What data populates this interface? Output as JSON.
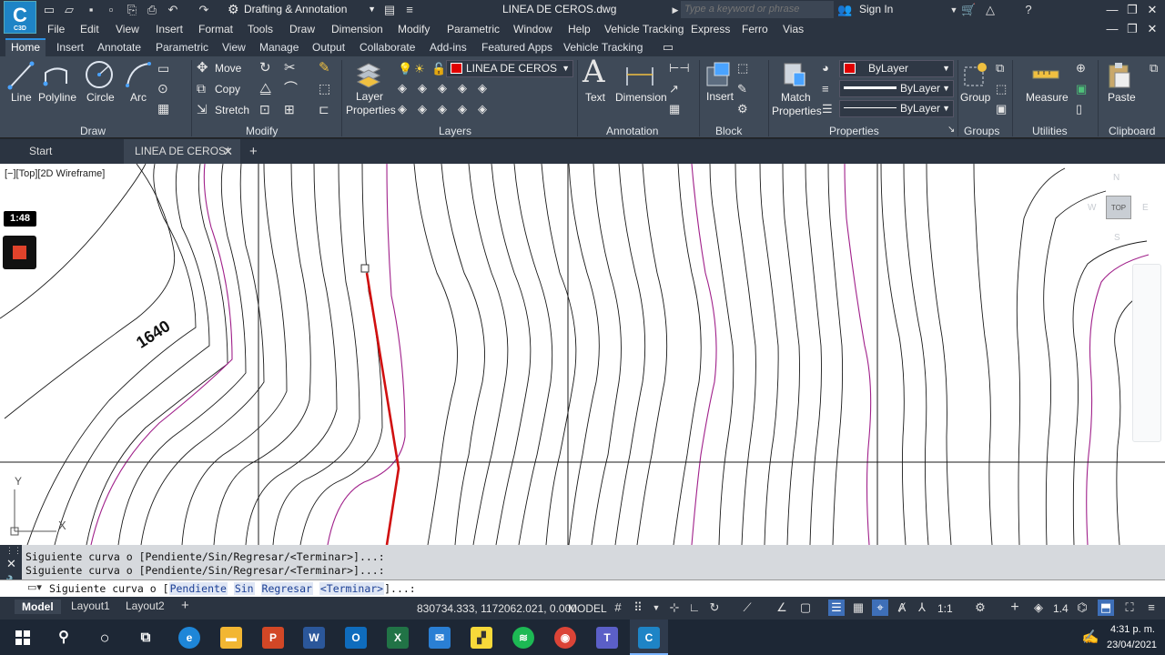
{
  "app": {
    "logo_text": "C",
    "logo_sub": "C3D",
    "title": "LINEA DE CEROS.dwg",
    "workspace": "Drafting & Annotation"
  },
  "search": {
    "placeholder": "Type a keyword or phrase"
  },
  "account": {
    "sign_in": "Sign In"
  },
  "menu": [
    "File",
    "Edit",
    "View",
    "Insert",
    "Format",
    "Tools",
    "Draw",
    "Dimension",
    "Modify",
    "Parametric",
    "Window",
    "Help",
    "Vehicle Tracking",
    "Express",
    "Ferro",
    "Vias"
  ],
  "ribbon_tabs": [
    "Home",
    "Insert",
    "Annotate",
    "Parametric",
    "View",
    "Manage",
    "Output",
    "Collaborate",
    "Add-ins",
    "Featured Apps",
    "Vehicle Tracking"
  ],
  "ribbon": {
    "draw": {
      "title": "Draw",
      "line": "Line",
      "polyline": "Polyline",
      "circle": "Circle",
      "arc": "Arc"
    },
    "modify": {
      "title": "Modify",
      "move": "Move",
      "copy": "Copy",
      "stretch": "Stretch"
    },
    "layers": {
      "title": "Layers",
      "layer_properties_1": "Layer",
      "layer_properties_2": "Properties",
      "current_layer": "LINEA DE CEROS"
    },
    "annotation": {
      "title": "Annotation",
      "text": "Text",
      "dimension": "Dimension"
    },
    "block": {
      "title": "Block",
      "insert": "Insert"
    },
    "properties": {
      "title": "Properties",
      "match_1": "Match",
      "match_2": "Properties",
      "color": "ByLayer",
      "lineweight": "ByLayer",
      "linetype": "ByLayer"
    },
    "groups": {
      "title": "Groups",
      "group": "Group"
    },
    "utilities": {
      "title": "Utilities",
      "measure": "Measure"
    },
    "clipboard": {
      "title": "Clipboard",
      "paste": "Paste"
    }
  },
  "file_tabs": [
    {
      "label": "Start"
    },
    {
      "label": "LINEA DE CEROS*"
    }
  ],
  "viewport": {
    "label": "[−][Top][2D Wireframe]",
    "contour_label": "1640",
    "ucs_y": "Y",
    "ucs_x": "X"
  },
  "viewcube": {
    "face": "TOP",
    "n": "N",
    "s": "S",
    "e": "E",
    "w": "W"
  },
  "recording": {
    "timer": "1:48"
  },
  "command": {
    "history": [
      "Siguiente curva o [Pendiente/Sin/Regresar/<Terminar>]...:",
      "Siguiente curva o [Pendiente/Sin/Regresar/<Terminar>]...:"
    ],
    "prompt_prefix": "Siguiente curva o [",
    "options": [
      "Pendiente",
      "Sin",
      "Regresar",
      "<Terminar>"
    ],
    "prompt_suffix": "]...:"
  },
  "layout_tabs": [
    "Model",
    "Layout1",
    "Layout2"
  ],
  "status": {
    "coords": "830734.333, 1172062.021, 0.000",
    "space": "MODEL",
    "scale": "1:1",
    "lineweight_value": "1.4"
  },
  "clock": {
    "time": "4:31 p. m.",
    "date": "23/04/2021"
  },
  "colors": {
    "accent": "#2c8ee0",
    "layer_color": "#e00000",
    "magenta_contour": "#a0208a",
    "zero_line": "#d01010"
  },
  "taskbar_apps": [
    "windows-start",
    "search",
    "cortana",
    "task-view",
    "edge",
    "file-explorer",
    "powerpoint",
    "word",
    "outlook",
    "excel",
    "mail",
    "sticky-notes",
    "spotify",
    "chrome",
    "teams",
    "civil3d"
  ]
}
